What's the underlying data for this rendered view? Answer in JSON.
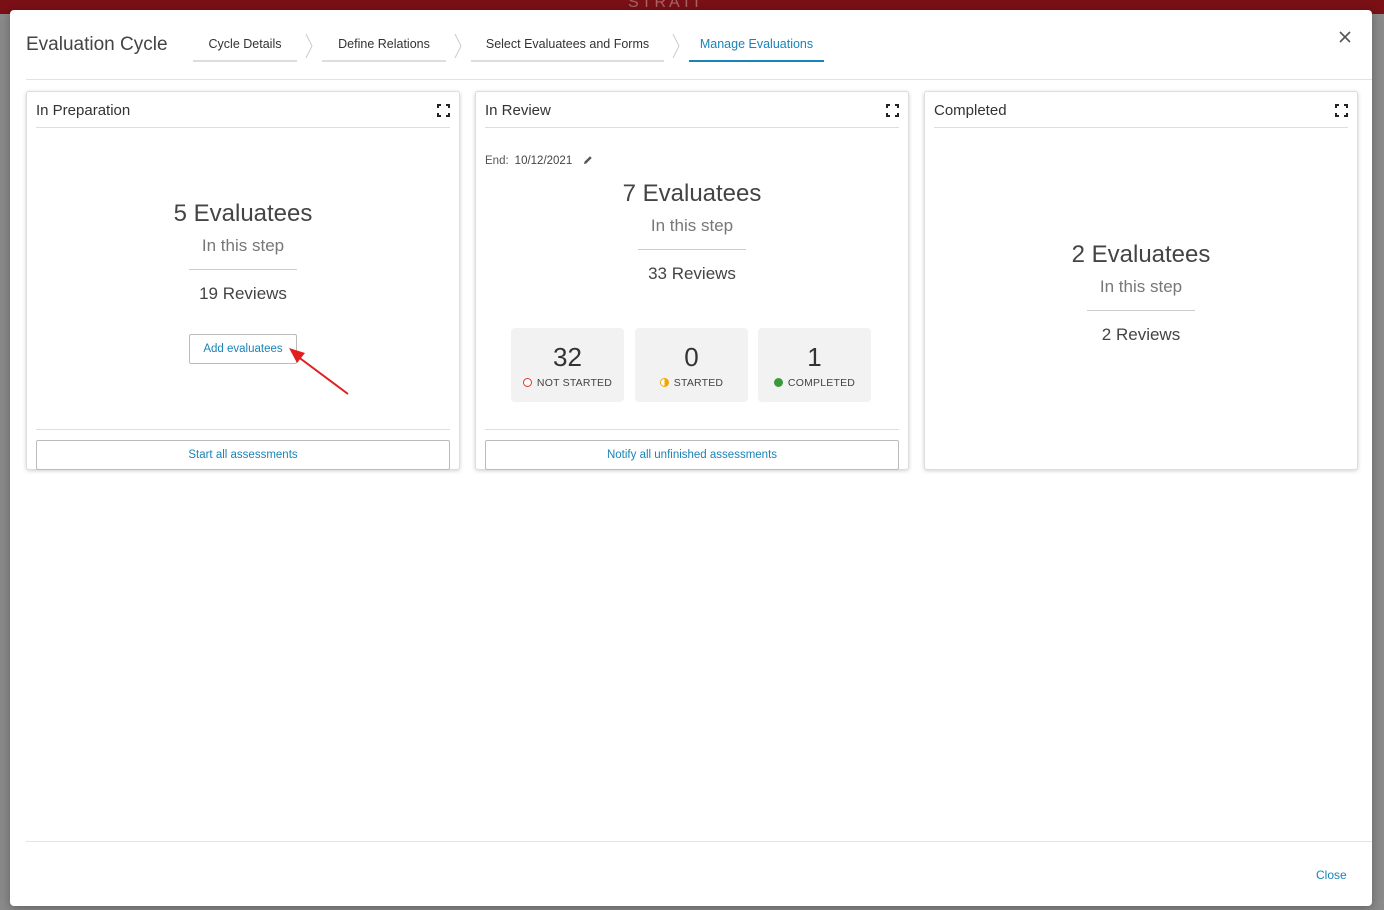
{
  "dialog": {
    "title": "Evaluation Cycle",
    "close_label": "Close"
  },
  "steps": [
    {
      "label": "Cycle Details",
      "active": false
    },
    {
      "label": "Define Relations",
      "active": false
    },
    {
      "label": "Select Evaluatees and Forms",
      "active": false
    },
    {
      "label": "Manage Evaluations",
      "active": true
    }
  ],
  "preparation": {
    "title": "In Preparation",
    "evaluatees": "5 Evaluatees",
    "subtitle": "In this step",
    "reviews": "19 Reviews",
    "add_label": "Add evaluatees",
    "action_label": "Start all assessments"
  },
  "review": {
    "title": "In Review",
    "end_label": "End:",
    "end_date": "10/12/2021",
    "evaluatees": "7 Evaluatees",
    "subtitle": "In this step",
    "reviews": "33 Reviews",
    "stats": [
      {
        "count": "32",
        "label": "NOT STARTED",
        "status_color": "#d33333"
      },
      {
        "count": "0",
        "label": "STARTED",
        "status_color": "#f0a500"
      },
      {
        "count": "1",
        "label": "COMPLETED",
        "status_color": "#3a9a3a"
      }
    ],
    "action_label": "Notify all unfinished assessments"
  },
  "completed": {
    "title": "Completed",
    "evaluatees": "2 Evaluatees",
    "subtitle": "In this step",
    "reviews": "2 Reviews"
  },
  "icons": {
    "close": "close-icon",
    "expand": "expand-icon",
    "edit": "pencil-icon",
    "step_separator": "chevron-right-icon"
  },
  "colors": {
    "accent": "#1a84b8",
    "header_bar": "#7a1016",
    "annotation_arrow": "#e02020"
  }
}
